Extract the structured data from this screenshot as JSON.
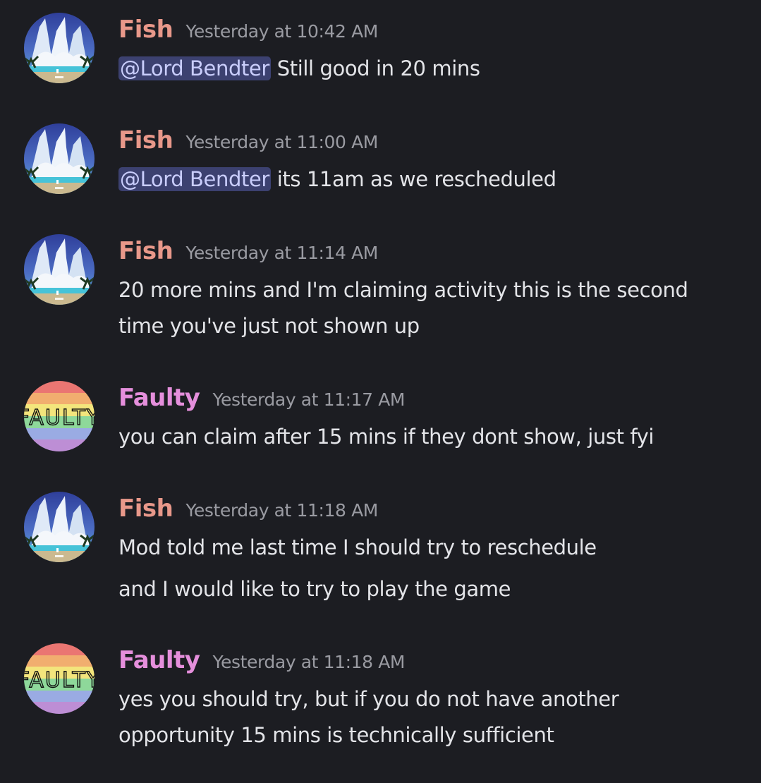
{
  "colors": {
    "background": "#1c1d22",
    "fish_name": "#e8988a",
    "faulty_name": "#e58fdc",
    "timestamp": "#9a9ba2",
    "mention_bg": "#3c4170"
  },
  "messages": [
    {
      "author": "Fish",
      "timestamp": "Yesterday at 10:42 AM",
      "mention": "@Lord Bendter",
      "text": " Still good in 20 mins"
    },
    {
      "author": "Fish",
      "timestamp": "Yesterday at 11:00 AM",
      "mention": "@Lord Bendter",
      "text": " its 11am as we rescheduled"
    },
    {
      "author": "Fish",
      "timestamp": "Yesterday at 11:14 AM",
      "lines": [
        "20 more mins and I'm claiming activity this is the second",
        "time you've just not shown up"
      ]
    },
    {
      "author": "Faulty",
      "timestamp": "Yesterday at 11:17 AM",
      "lines": [
        "you can claim after 15 mins if they dont show, just fyi"
      ]
    },
    {
      "author": "Fish",
      "timestamp": "Yesterday at 11:18 AM",
      "lines": [
        "Mod told me last time I should try to reschedule",
        "and I would like to try to play the game"
      ]
    },
    {
      "author": "Faulty",
      "timestamp": "Yesterday at 11:18 AM",
      "lines": [
        "yes you should try, but if you do not have another",
        "opportunity 15 mins is technically sufficient"
      ]
    }
  ],
  "avatars": {
    "fish": {
      "icon": "waterfall-landscape-avatar-icon"
    },
    "faulty": {
      "icon": "rainbow-faulty-avatar-icon",
      "text": "FAULTY"
    }
  }
}
